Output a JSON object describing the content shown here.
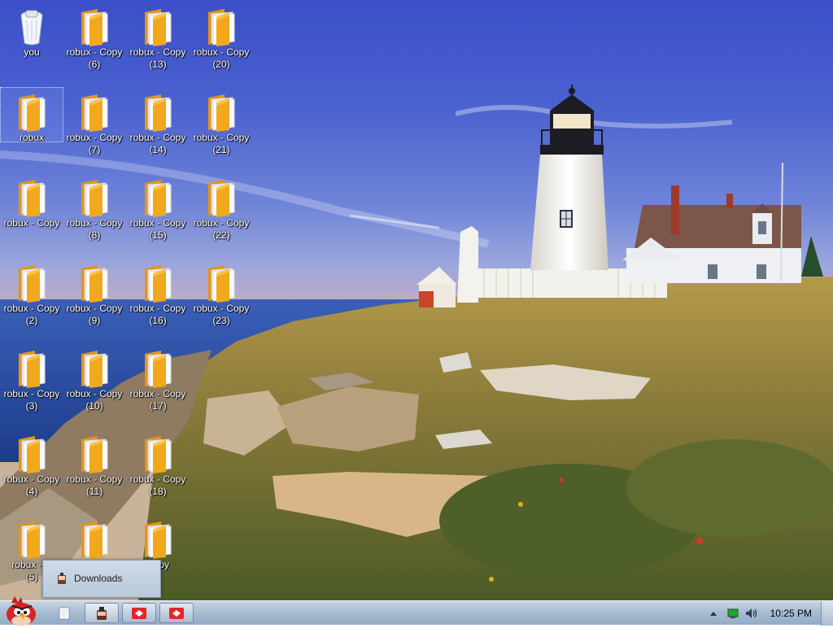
{
  "desktop": {
    "icons": [
      {
        "label": "you",
        "type": "recycle-bin"
      },
      {
        "label": "robux",
        "type": "folder"
      },
      {
        "label": "robux - Copy",
        "type": "folder"
      },
      {
        "label": "robux - Copy\n(2)",
        "type": "folder"
      },
      {
        "label": "robux - Copy\n(3)",
        "type": "folder"
      },
      {
        "label": "robux - Copy\n(4)",
        "type": "folder"
      },
      {
        "label": "robux - C\n(5)",
        "type": "folder"
      },
      {
        "label": "robux - Copy\n(6)",
        "type": "folder"
      },
      {
        "label": "robux - Copy\n(7)",
        "type": "folder"
      },
      {
        "label": "robux - Copy\n(8)",
        "type": "folder"
      },
      {
        "label": "robux - Copy\n(9)",
        "type": "folder"
      },
      {
        "label": "robux - Copy\n(10)",
        "type": "folder"
      },
      {
        "label": "robux - Copy\n(11)",
        "type": "folder"
      },
      {
        "label": "",
        "type": "folder"
      },
      {
        "label": "robux - Copy\n(13)",
        "type": "folder"
      },
      {
        "label": "robux - Copy\n(14)",
        "type": "folder"
      },
      {
        "label": "robux - Copy\n(15)",
        "type": "folder"
      },
      {
        "label": "robux - Copy\n(16)",
        "type": "folder"
      },
      {
        "label": "robux - Copy\n(17)",
        "type": "folder"
      },
      {
        "label": "robux - Copy\n(18)",
        "type": "folder"
      },
      {
        "label": "Copy\n)",
        "type": "folder"
      },
      {
        "label": "robux - Copy\n(20)",
        "type": "folder"
      },
      {
        "label": "robux - Copy\n(21)",
        "type": "folder"
      },
      {
        "label": "robux - Copy\n(22)",
        "type": "folder"
      },
      {
        "label": "robux - Copy\n(23)",
        "type": "folder"
      }
    ],
    "selected_icon": "robux"
  },
  "jumplist": {
    "item_label": "Downloads"
  },
  "taskbar": {
    "start_icon": "angry-bird-orb-icon",
    "buttons": [
      {
        "name": "notepad",
        "icon": "document-icon"
      },
      {
        "name": "downloads-window",
        "icon": "downloads-icon"
      },
      {
        "name": "app-window-1",
        "icon": "red-app-icon"
      },
      {
        "name": "app-window-2",
        "icon": "red-app-icon"
      }
    ],
    "clock": "10:25 PM",
    "tray_icons": [
      "show-hidden-icons-icon",
      "network-icon",
      "volume-icon"
    ]
  },
  "colors": {
    "taskbar": "#a8bdd3",
    "folder": "#f2a81c",
    "sky": "#3a4fc7",
    "accent_red": "#e4262b"
  }
}
